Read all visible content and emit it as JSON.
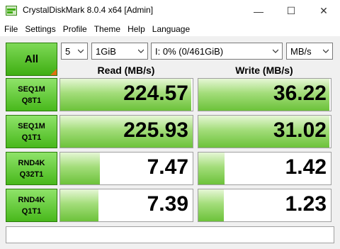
{
  "window": {
    "title": "CrystalDiskMark 8.0.4 x64 [Admin]",
    "min_glyph": "—",
    "max_glyph": "☐",
    "close_glyph": "✕"
  },
  "menu": [
    "File",
    "Settings",
    "Profile",
    "Theme",
    "Help",
    "Language"
  ],
  "controls": {
    "all_label": "All",
    "count": "5",
    "size": "1GiB",
    "drive": "I: 0% (0/461GiB)",
    "unit": "MB/s"
  },
  "headers": {
    "read": "Read (MB/s)",
    "write": "Write (MB/s)"
  },
  "rows": [
    {
      "line1": "SEQ1M",
      "line2": "Q8T1",
      "read": "224.57",
      "write": "36.22",
      "read_level": 0.99,
      "write_level": 0.99
    },
    {
      "line1": "SEQ1M",
      "line2": "Q1T1",
      "read": "225.93",
      "write": "31.02",
      "read_level": 1.0,
      "write_level": 0.99
    },
    {
      "line1": "RND4K",
      "line2": "Q32T1",
      "read": "7.47",
      "write": "1.42",
      "read_level": 0.3,
      "write_level": 0.2
    },
    {
      "line1": "RND4K",
      "line2": "Q1T1",
      "read": "7.39",
      "write": "1.23",
      "read_level": 0.29,
      "write_level": 0.19
    }
  ],
  "colors": {
    "accent_green": "#48b81b",
    "fill_green": "#6cc23a",
    "corner_orange": "#e07010"
  }
}
